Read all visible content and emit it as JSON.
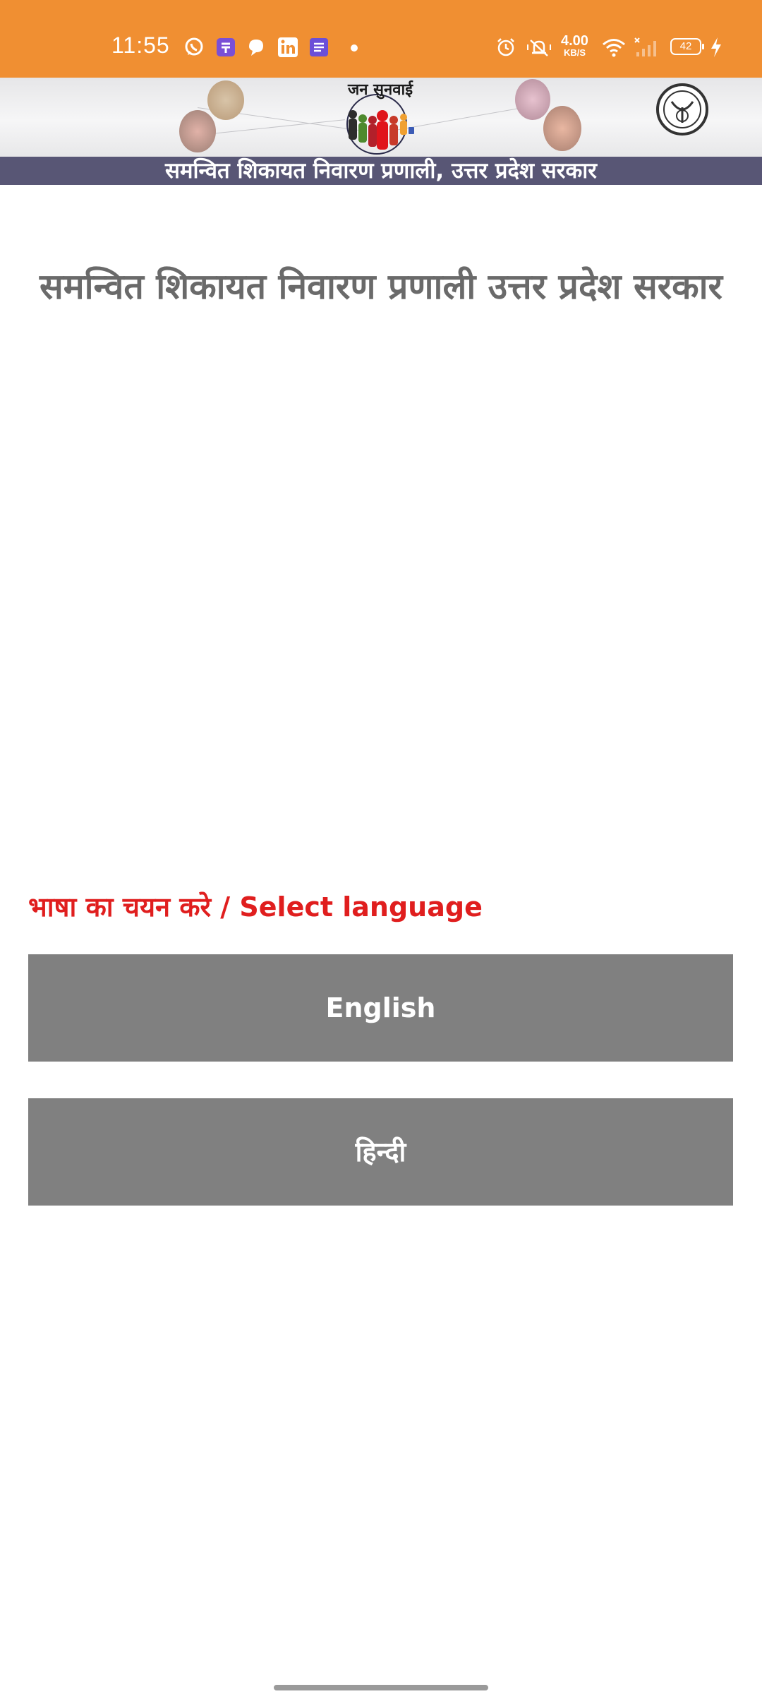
{
  "status_bar": {
    "time": "11:55",
    "network_speed_value": "4.00",
    "network_speed_unit": "KB/S",
    "battery": "42",
    "icons": [
      "whatsapp-icon",
      "app-icon",
      "chat-icon",
      "linkedin-icon",
      "notes-icon",
      "alarm-icon",
      "mute-icon",
      "wifi-icon",
      "signal-icon",
      "charging-icon"
    ],
    "bg_color": "#f08f32"
  },
  "banner": {
    "logo_text": "जन सुनवाई",
    "strip_text": "समन्वित शिकायत निवारण प्रणाली, उत्तर प्रदेश सरकार",
    "strip_color": "#585675"
  },
  "main": {
    "title": "समन्वित शिकायत निवारण प्रणाली उत्तर प्रदेश सरकार",
    "title_color": "#6a6a6a",
    "language_prompt": "भाषा का चयन करे / Select language",
    "prompt_color": "#e01e1e",
    "buttons": {
      "english": "English",
      "hindi": "हिन्दी",
      "color": "#808080"
    }
  }
}
